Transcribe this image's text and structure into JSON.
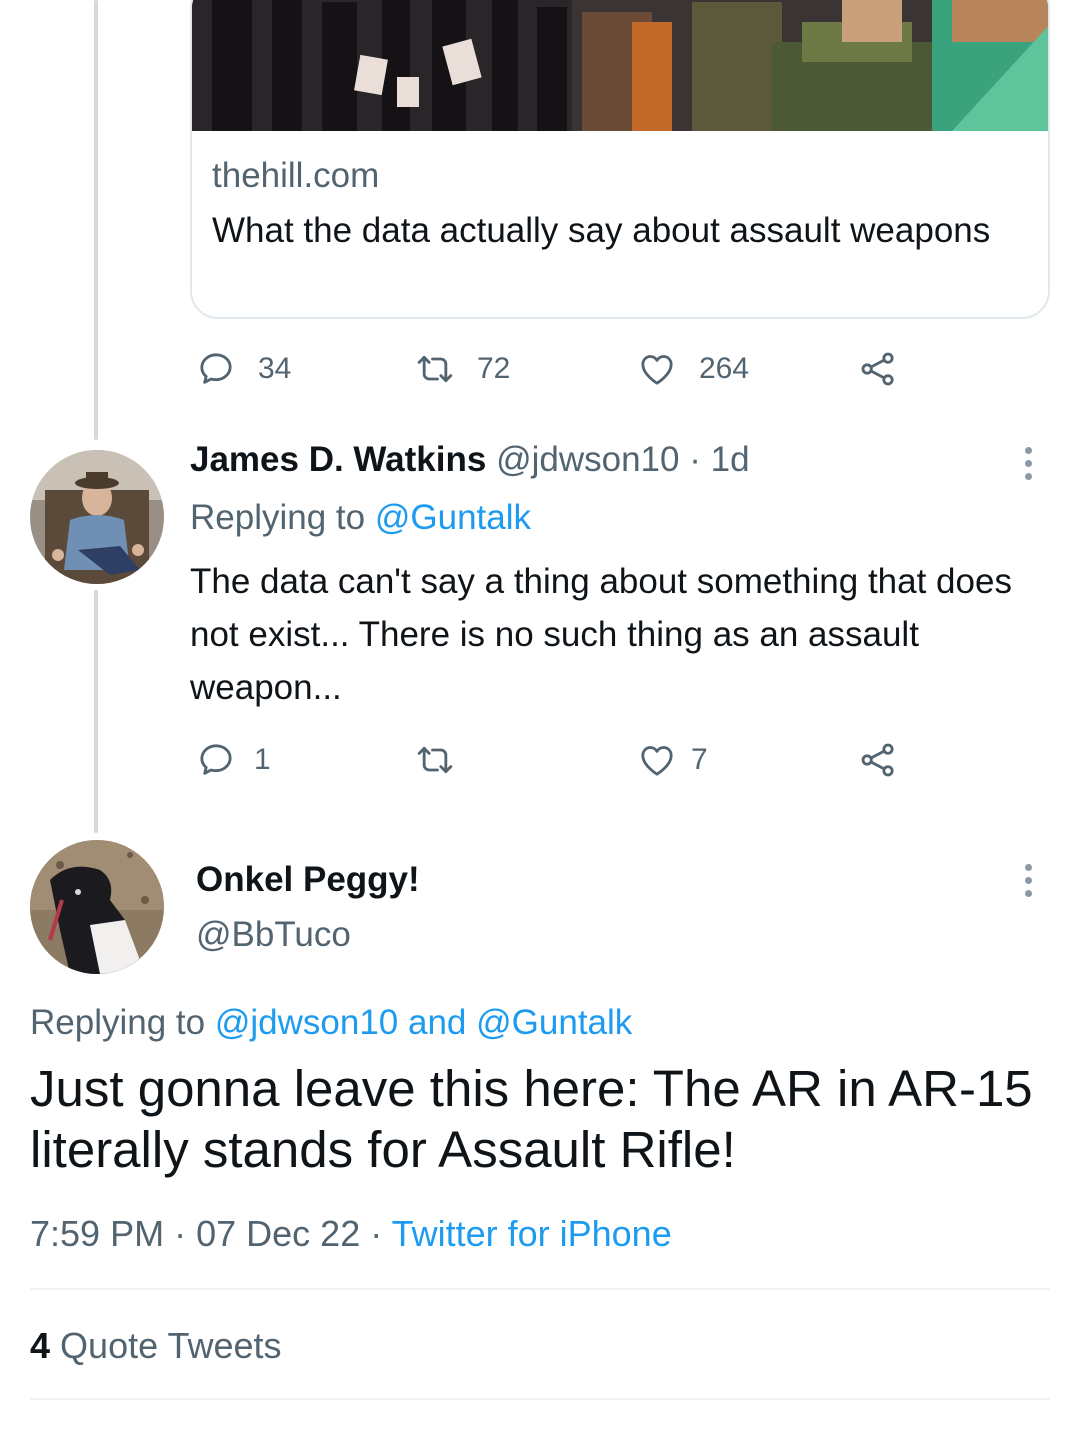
{
  "link_card": {
    "domain": "thehill.com",
    "title": "What the data actually say about assault weapons"
  },
  "first_tweet_actions": {
    "replies": "34",
    "retweets": "72",
    "likes": "264"
  },
  "reply_tweet": {
    "name": "James D. Watkins",
    "handle": "@jdwson10",
    "separator": "·",
    "time": "1d",
    "replying_prefix": "Replying to",
    "replying_mention": "@Guntalk",
    "text": "The data can't say a thing about something that does not exist... There is no such thing as an assault weapon...",
    "actions": {
      "replies": "1",
      "retweets": "",
      "likes": "7"
    }
  },
  "main_tweet": {
    "name": "Onkel Peggy!",
    "handle": "@BbTuco",
    "replying_prefix": "Replying to",
    "replying_mention_1": "@jdwson10",
    "replying_and": "and",
    "replying_mention_2": "@Guntalk",
    "text": "Just gonna leave this here: The AR in AR-15 literally stands for Assault Rifle!",
    "time": "7:59 PM",
    "separator": "·",
    "date": "07 Dec 22",
    "source": "Twitter for iPhone"
  },
  "quote_tweets": {
    "count": "4",
    "label": "Quote Tweets"
  },
  "colors": {
    "accent": "#1d9bf0",
    "muted_text": "#536471",
    "primary_text": "#0f1419",
    "thread_line": "#cfd9de"
  }
}
